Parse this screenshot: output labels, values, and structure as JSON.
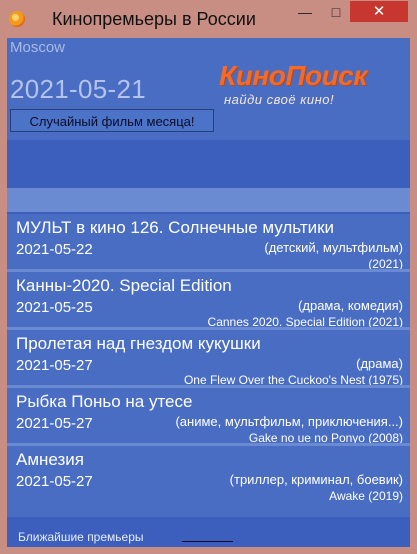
{
  "window": {
    "title": "Кинопремьеры в России",
    "icon": "app-orange-icon",
    "controls": {
      "minimize": "—",
      "maximize": "□",
      "close": "✕"
    }
  },
  "header": {
    "city": "Moscow",
    "date": "2021-05-21",
    "logo_text": "КиноПоиск",
    "logo_tagline": "найди своё кино!",
    "random_button": "Случайный фильм месяца!"
  },
  "movies": [
    {
      "title": "МУЛЬТ в кино 126. Солнечные мультики",
      "date": "2021-05-22",
      "genres": "(детский, мультфильм)",
      "original": "(2021)"
    },
    {
      "title": "Канны-2020. Special Edition",
      "date": "2021-05-25",
      "genres": "(драма, комедия)",
      "original": "Cannes 2020. Special Edition  (2021)"
    },
    {
      "title": "Пролетая над гнездом кукушки",
      "date": "2021-05-27",
      "genres": "(драма)",
      "original": "One Flew Over the Cuckoo's Nest  (1975)"
    },
    {
      "title": "Рыбка Поньо на утесе",
      "date": "2021-05-27",
      "genres": "(аниме, мультфильм, приключения...)",
      "original": "Gake no ue no Ponyo  (2008)"
    },
    {
      "title": "Амнезия",
      "date": "2021-05-27",
      "genres": "(триллер, криминал, боевик)",
      "original": "Awake  (2019)"
    }
  ],
  "footer": {
    "label": "Ближайшие премьеры"
  },
  "colors": {
    "titlebar": "#c88e84",
    "close_button": "#c7372f",
    "panel": "#4a6dc4",
    "accent_band": "#6a8bd2",
    "logo_orange": "#f26b2a"
  }
}
